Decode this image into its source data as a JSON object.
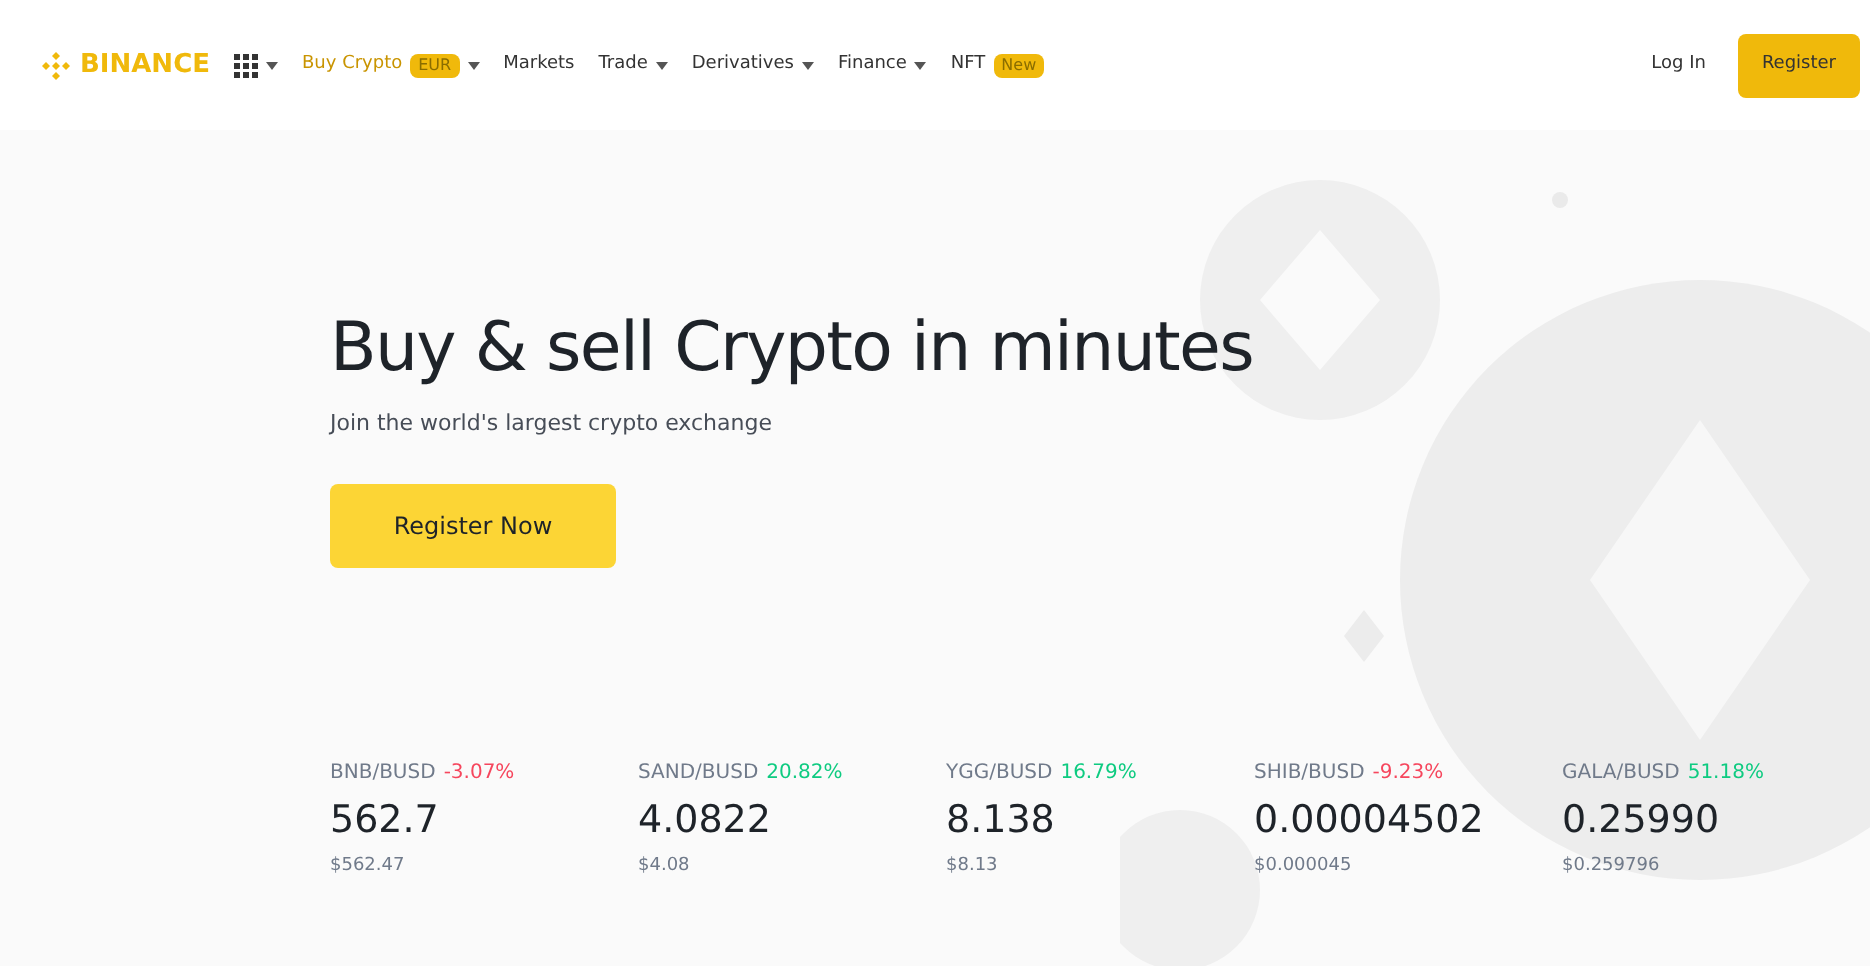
{
  "header": {
    "logo": "BINANCE",
    "nav": [
      {
        "label": "Buy Crypto",
        "badge": "EUR",
        "dropdown": true
      },
      {
        "label": "Markets",
        "dropdown": false
      },
      {
        "label": "Trade",
        "dropdown": true
      },
      {
        "label": "Derivatives",
        "dropdown": true
      },
      {
        "label": "Finance",
        "dropdown": true
      },
      {
        "label": "NFT",
        "badge": "New",
        "dropdown": false
      }
    ],
    "login": "Log In",
    "register": "Register"
  },
  "hero": {
    "title": "Buy & sell Crypto in minutes",
    "subtitle": "Join the world's largest crypto exchange",
    "cta": "Register Now"
  },
  "tickers": [
    {
      "pair": "BNB/BUSD",
      "change": "-3.07%",
      "color": "#f6465d",
      "price": "562.7",
      "usd": "$562.47"
    },
    {
      "pair": "SAND/BUSD",
      "change": "20.82%",
      "color": "#0ecb81",
      "price": "4.0822",
      "usd": "$4.08"
    },
    {
      "pair": "YGG/BUSD",
      "change": "16.79%",
      "color": "#0ecb81",
      "price": "8.138",
      "usd": "$8.13"
    },
    {
      "pair": "SHIB/BUSD",
      "change": "-9.23%",
      "color": "#f6465d",
      "price": "0.00004502",
      "usd": "$0.000045"
    },
    {
      "pair": "GALA/BUSD",
      "change": "51.18%",
      "color": "#0ecb81",
      "price": "0.25990",
      "usd": "$0.259796"
    }
  ]
}
